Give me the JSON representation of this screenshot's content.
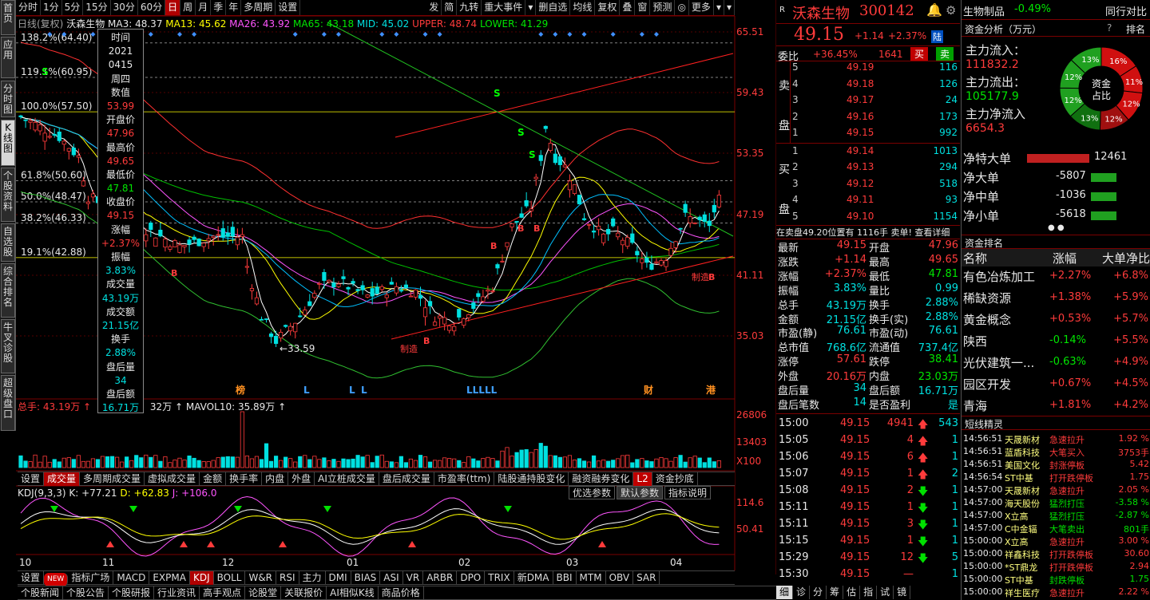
{
  "left_tabs": [
    "首页",
    "应用",
    "分时图",
    "K线图",
    "个股资料",
    "自选股",
    "综合排名",
    "牛叉诊股",
    "超级盘口"
  ],
  "toolbar": [
    "分时",
    "1分",
    "5分",
    "15分",
    "30分",
    "60分",
    "日",
    "周",
    "月",
    "季",
    "年",
    "多周期",
    "设置"
  ],
  "toolbar_right": [
    "发",
    "简",
    "九转",
    "重大事件",
    "▾",
    "删自选",
    "均线",
    "复权",
    "叠",
    "窗",
    "预测",
    "◎",
    "更多",
    "▾",
    "▾"
  ],
  "legend": {
    "period": "日线(复权)",
    "name": "沃森生物",
    "ma3": "MA3: 48.37",
    "ma13": "MA13: 45.62",
    "ma26": "MA26: 43.92",
    "ma65": "MA65: 43.18",
    "mid": "MID: 45.02",
    "upper": "UPPER: 48.74",
    "lower": "LOWER: 41.29"
  },
  "price_axis": [
    "65.51",
    "59.43",
    "53.35",
    "47.19",
    "41.11",
    "35.03"
  ],
  "fib_labels": [
    "138.2%(64.40)",
    "119.1%(60.95)",
    "100.0%(57.50)",
    "61.8%(50.60)",
    "50.0%(48.47)",
    "38.2%(46.33)",
    "19.1%(42.88)"
  ],
  "chart_marks": {
    "low": "33.59",
    "x_axis": [
      "10",
      "11",
      "12",
      "01",
      "02",
      "03",
      "04"
    ],
    "events": [
      "榜",
      "L",
      "L",
      "L",
      "LLLLL",
      "财",
      "港"
    ],
    "labels": [
      "制造",
      "制造"
    ]
  },
  "popup": [
    "时间",
    "2021",
    "0415",
    "周四",
    "数值",
    "53.99",
    "开盘价",
    "47.96",
    "最高价",
    "49.65",
    "最低价",
    "47.81",
    "收盘价",
    "49.15",
    "涨幅",
    "+2.37%",
    "振幅",
    "3.83%",
    "成交量",
    "43.19万",
    "成交额",
    "21.15亿",
    "换手",
    "2.88%",
    "盘后量",
    "34",
    "盘后额",
    "16.71万"
  ],
  "volume": {
    "legend": "总手: 43.19万 ↑",
    "mavol5": "32万 ↑",
    "mavol10": "MAVOL10: 35.89万 ↑",
    "axis": [
      "26806",
      "13403",
      "X100"
    ]
  },
  "vol_tabs": [
    "设置",
    "成交量",
    "多周期成交量",
    "虚拟成交量",
    "金额",
    "换手率",
    "内盘",
    "外盘",
    "AI立桩成交量",
    "盘后成交量",
    "市盈率(ttm)",
    "陆股通持股变化",
    "融资融券变化",
    "L2",
    "资金抄底"
  ],
  "kdj": {
    "legend": "KDJ(9,3,3)",
    "k": "K: +77.21",
    "d": "D: +62.83",
    "j": "J: +106.0",
    "axis": [
      "114.6",
      "50.41"
    ],
    "buttons": [
      "优选参数",
      "默认参数",
      "指标说明"
    ]
  },
  "ind_tabs": [
    "设置",
    "NEW",
    "指标广场",
    "MACD",
    "EXPMA",
    "KDJ",
    "BOLL",
    "W&R",
    "RSI",
    "主力",
    "DMI",
    "BIAS",
    "ASI",
    "VR",
    "ARBR",
    "DPO",
    "TRIX",
    "新DMA",
    "BBI",
    "MTM",
    "OBV",
    "SAR"
  ],
  "bottom_tabs": [
    "个股新闻",
    "个股公告",
    "个股研报",
    "行业资讯",
    "高手观点",
    "论股堂",
    "关联报价",
    "AI相似K线",
    "商品价格"
  ],
  "stock": {
    "name": "沃森生物",
    "code": "300142",
    "price": "49.15",
    "chg": "+1.14",
    "pct": "+2.37%",
    "tag": "陆",
    "weibi_label": "委比",
    "weibi": "+36.45%",
    "weicha": "1641",
    "buy": "买",
    "sell": "卖"
  },
  "asks": [
    {
      "n": "5",
      "p": "49.19",
      "v": "116"
    },
    {
      "n": "4",
      "p": "49.18",
      "v": "126"
    },
    {
      "n": "3",
      "p": "49.17",
      "v": "24"
    },
    {
      "n": "2",
      "p": "49.16",
      "v": "173"
    },
    {
      "n": "1",
      "p": "49.15",
      "v": "992"
    }
  ],
  "bids": [
    {
      "n": "1",
      "p": "49.14",
      "v": "1013"
    },
    {
      "n": "2",
      "p": "49.13",
      "v": "294"
    },
    {
      "n": "3",
      "p": "49.12",
      "v": "518"
    },
    {
      "n": "4",
      "p": "49.11",
      "v": "93"
    },
    {
      "n": "5",
      "p": "49.10",
      "v": "1154"
    }
  ],
  "ask_side": [
    "卖",
    "盘"
  ],
  "bid_side": [
    "买",
    "盘"
  ],
  "note": "在卖盘49.20位置有 1116手 卖单! 查看详细",
  "stats": [
    [
      "最新",
      "49.15",
      "开盘",
      "47.96"
    ],
    [
      "涨跌",
      "+1.14",
      "最高",
      "49.65"
    ],
    [
      "涨幅",
      "+2.37%",
      "最低",
      "47.81"
    ],
    [
      "振幅",
      "3.83%",
      "量比",
      "0.99"
    ],
    [
      "总手",
      "43.19万",
      "换手",
      "2.88%"
    ],
    [
      "金额",
      "21.15亿",
      "换手(实)",
      "2.88%"
    ],
    [
      "市盈(静)",
      "76.61",
      "市盈(动)",
      "76.61"
    ],
    [
      "总市值",
      "768.6亿",
      "流通值",
      "737.4亿"
    ],
    [
      "涨停",
      "57.61",
      "跌停",
      "38.41"
    ],
    [
      "外盘",
      "20.16万",
      "内盘",
      "23.03万"
    ],
    [
      "盘后量",
      "34",
      "盘后额",
      "16.71万"
    ],
    [
      "盘后笔数",
      "14",
      "是否盈利",
      "是"
    ]
  ],
  "ticks": [
    [
      "15:00",
      "49.15",
      "4941",
      "up",
      "543"
    ],
    [
      "15:05",
      "49.15",
      "4",
      "up",
      "1"
    ],
    [
      "15:06",
      "49.15",
      "6",
      "up",
      "1"
    ],
    [
      "15:07",
      "49.15",
      "1",
      "up",
      "2"
    ],
    [
      "15:08",
      "49.15",
      "2",
      "dn",
      "1"
    ],
    [
      "15:11",
      "49.15",
      "1",
      "dn",
      "1"
    ],
    [
      "15:11",
      "49.15",
      "3",
      "dn",
      "1"
    ],
    [
      "15:15",
      "49.15",
      "1",
      "dn",
      "1"
    ],
    [
      "15:29",
      "49.15",
      "12",
      "dn",
      "5"
    ],
    [
      "15:30",
      "49.15",
      "—",
      "",
      "1"
    ]
  ],
  "tick_tabs": [
    "细",
    "诊",
    "分",
    "筹",
    "估",
    "指",
    "试",
    "镜"
  ],
  "rpanel": {
    "sector": "生物制品",
    "sector_pct": "-0.49%",
    "compare": "同行对比",
    "capital_title": "资金分析（万元）",
    "rank_btn": "排名",
    "help": "?",
    "inflow_l": "主力流入：",
    "inflow": "111832.2",
    "outflow_l": "主力流出：",
    "outflow": "105177.9",
    "net_l": "主力净流入",
    "net": "6654.3",
    "donut_center": "资金\n占比",
    "donut": [
      "13%",
      "16%",
      "11%",
      "12%",
      "12%",
      "13%",
      "12%",
      "12%"
    ],
    "flows": [
      [
        "净特大单",
        "12461",
        "r"
      ],
      [
        "净大单",
        "-5807",
        "g"
      ],
      [
        "净中单",
        "-1036",
        "g"
      ],
      [
        "净小单",
        "-5618",
        "g"
      ]
    ],
    "rank_title": "资金排名",
    "rank_cols": [
      "名称",
      "涨幅",
      "大单净比"
    ],
    "ranks": [
      [
        "有色冶炼加工",
        "+2.27%",
        "+6.8%"
      ],
      [
        "稀缺资源",
        "+1.38%",
        "+5.9%"
      ],
      [
        "黄金概念",
        "+0.53%",
        "+5.7%"
      ],
      [
        "陕西",
        "-0.14%",
        "+5.5%"
      ],
      [
        "光伏建筑一...",
        "-0.63%",
        "+4.9%"
      ],
      [
        "园区开发",
        "+0.67%",
        "+4.5%"
      ],
      [
        "青海",
        "+1.81%",
        "+4.2%"
      ]
    ],
    "sjtitle": "短线精灵",
    "sj": [
      [
        "14:56:51",
        "天晟新材",
        "急速拉升",
        "1.92 %",
        "r"
      ],
      [
        "14:56:51",
        "蓝盾科技",
        "大笔买入",
        "3753手",
        "r"
      ],
      [
        "14:56:51",
        "美国文化",
        "封涨停板",
        "5.42",
        "r"
      ],
      [
        "14:56:54",
        "ST中基",
        "打开跌停板",
        "1.75",
        "r"
      ],
      [
        "14:57:00",
        "天晟新材",
        "急速拉升",
        "2.05 %",
        "r"
      ],
      [
        "14:57:00",
        "海天股份",
        "猛烈打压",
        "-3.58 %",
        "g"
      ],
      [
        "14:57:00",
        "X立高",
        "猛烈打压",
        "-2.87 %",
        "g"
      ],
      [
        "14:57:00",
        "C中金辐",
        "大笔卖出",
        "801手",
        "g"
      ],
      [
        "15:00:00",
        "X立高",
        "急速拉升",
        "3.00 %",
        "r"
      ],
      [
        "15:00:00",
        "祥鑫科技",
        "打开跌停板",
        "30.60",
        "r"
      ],
      [
        "15:00:00",
        "*ST鼎龙",
        "打开跌停板",
        "2.94",
        "r"
      ],
      [
        "15:00:00",
        "ST中基",
        "封跌停板",
        "1.75",
        "g"
      ],
      [
        "15:00:00",
        "祥生医疗",
        "急速拉升",
        "2.22 %",
        "r"
      ]
    ]
  },
  "colors": {
    "up": "#ff3b3b",
    "down": "#00e0e0",
    "accent": "#b00000"
  }
}
